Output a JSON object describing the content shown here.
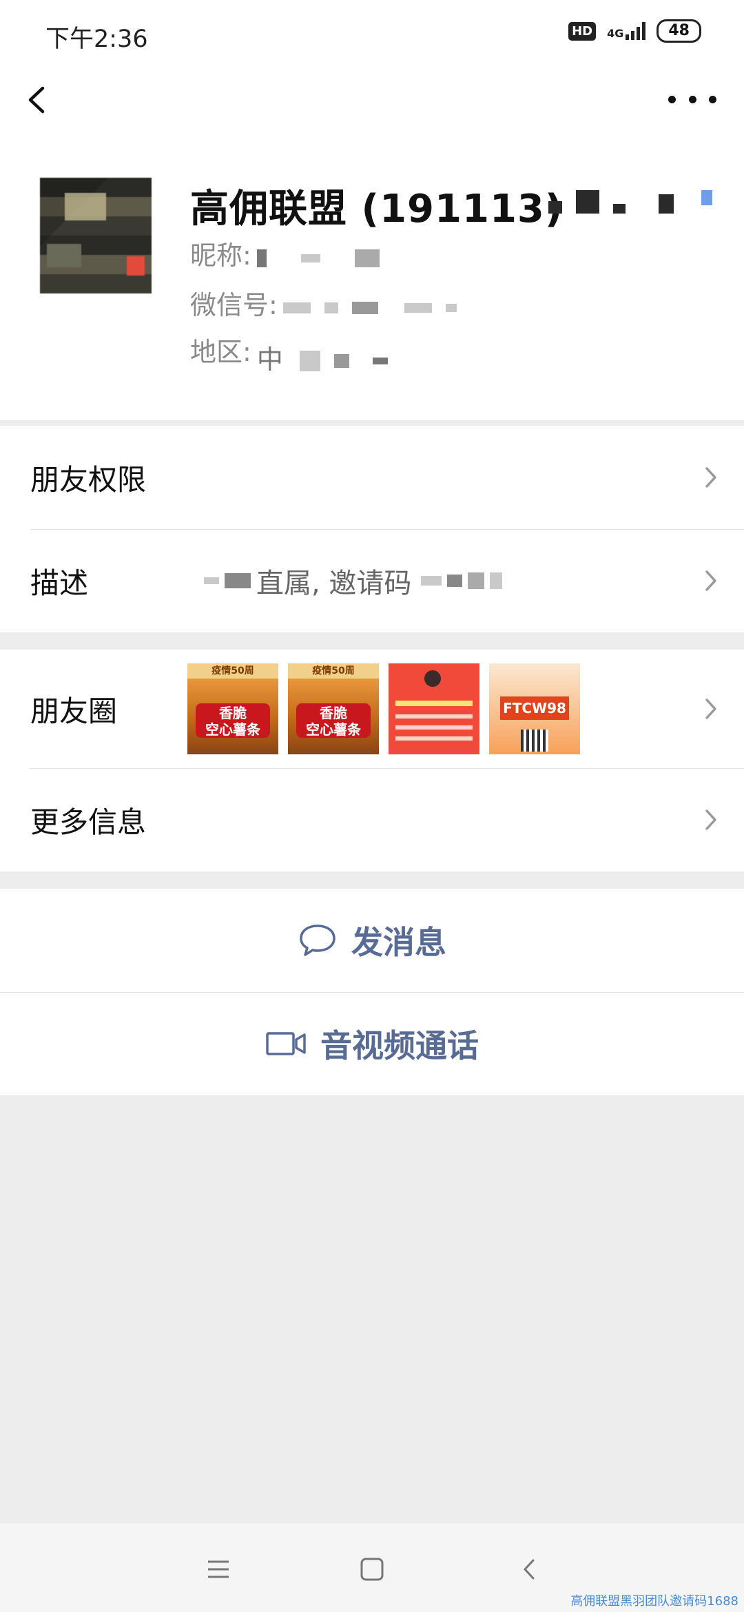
{
  "status_bar": {
    "time": "下午2:36",
    "hd": "HD",
    "network": "4G",
    "battery": "48"
  },
  "profile": {
    "name": "高佣联盟 (191113)",
    "nickname_label": "昵称:",
    "wechat_id_label": "微信号:",
    "region_label": "地区:",
    "region_value_fragment": "中"
  },
  "menu": {
    "friend_permissions": "朋友权限",
    "description_label": "描述",
    "description_value": "直属, 邀请码",
    "moments": "朋友圈",
    "more_info": "更多信息"
  },
  "moments_thumbs": [
    {
      "kind": "food",
      "top": "疫情50周",
      "text": "香脆\n空心薯条"
    },
    {
      "kind": "food",
      "top": "疫情50周",
      "text": "香脆\n空心薯条"
    },
    {
      "kind": "red"
    },
    {
      "kind": "orange",
      "code": "FTCW98"
    }
  ],
  "actions": {
    "send_message": "发消息",
    "video_call": "音视频通话"
  },
  "colors": {
    "link_blue": "#576b95",
    "background": "#ededed"
  },
  "watermark": "高佣联盟黑羽团队邀请码1688"
}
